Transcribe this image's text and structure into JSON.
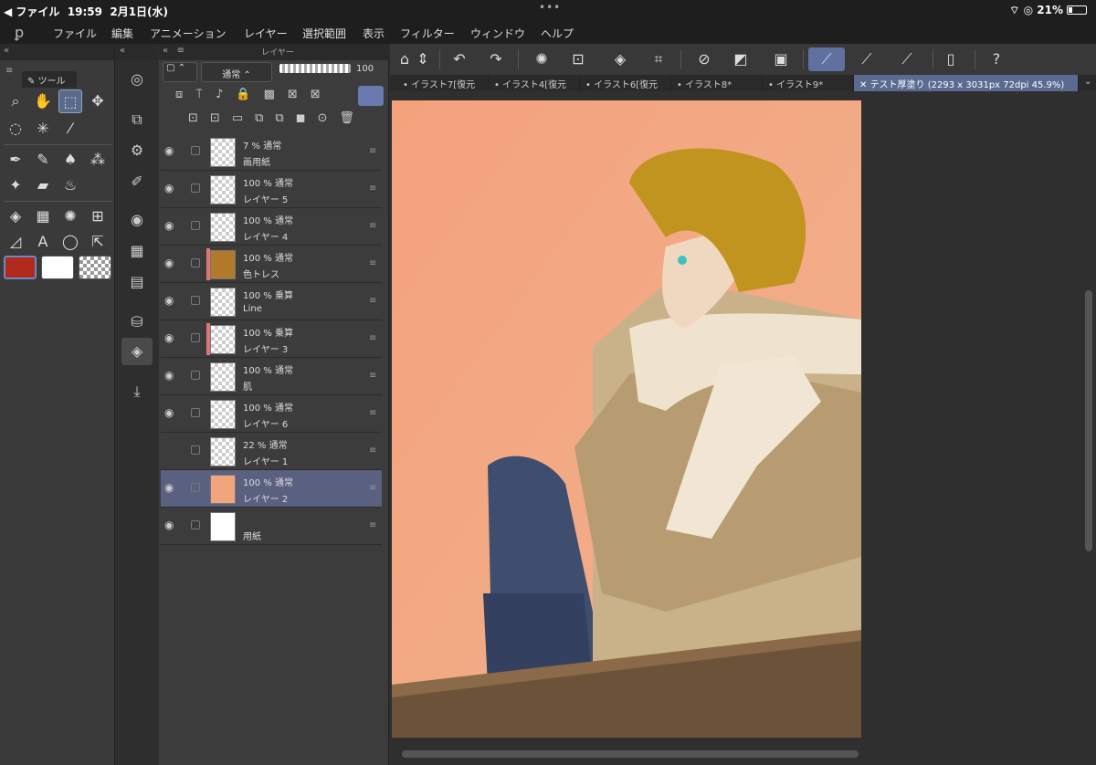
{
  "status": {
    "back": "◀ ファイル",
    "time": "19:59",
    "date": "2月1日(水)",
    "battery": "21%"
  },
  "menu": [
    "ファイル",
    "編集",
    "アニメーション",
    "レイヤー",
    "選択範囲",
    "表示",
    "フィルター",
    "ウィンドウ",
    "ヘルプ"
  ],
  "tool_panel": {
    "tab_label": "ツール",
    "colors": {
      "main": "#b22a1e",
      "sub": "#ffffff"
    }
  },
  "layer_panel": {
    "title": "レイヤー",
    "blend_mode": "通常",
    "opacity": "100",
    "layers": [
      {
        "opacity_mode": "7 % 通常",
        "name": "画用紙",
        "thumb": "checker"
      },
      {
        "opacity_mode": "100 % 通常",
        "name": "レイヤー 5",
        "thumb": "checker"
      },
      {
        "opacity_mode": "100 % 通常",
        "name": "レイヤー 4",
        "thumb": "checker"
      },
      {
        "opacity_mode": "100 % 通常",
        "name": "色トレス",
        "thumb": "brown",
        "color_bar": true
      },
      {
        "opacity_mode": "100 % 乗算",
        "name": "Line",
        "thumb": "checker"
      },
      {
        "opacity_mode": "100 % 乗算",
        "name": "レイヤー 3",
        "thumb": "checker",
        "color_bar": true
      },
      {
        "opacity_mode": "100 % 通常",
        "name": "肌",
        "thumb": "checker"
      },
      {
        "opacity_mode": "100 % 通常",
        "name": "レイヤー 6",
        "thumb": "checker"
      },
      {
        "opacity_mode": "22 % 通常",
        "name": "レイヤー 1",
        "thumb": "checker",
        "hidden": true
      },
      {
        "opacity_mode": "100 % 通常",
        "name": "レイヤー 2",
        "thumb": "peach",
        "selected": true
      },
      {
        "opacity_mode": "",
        "name": "用紙",
        "thumb": "white"
      }
    ]
  },
  "tabs": [
    "イラスト7[復元",
    "イラスト4[復元",
    "イラスト6[復元",
    "イラスト8*",
    "イラスト9*",
    "テスト厚塗り (2293 x 3031px 72dpi 45.9%)"
  ],
  "canvas": {
    "bg": "#f1a57c"
  }
}
